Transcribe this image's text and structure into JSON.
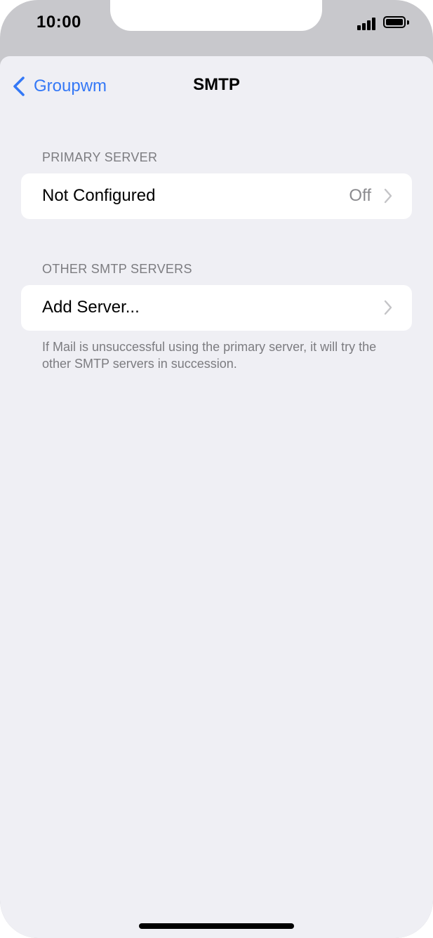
{
  "status_bar": {
    "time": "10:00",
    "signal_icon": "cellular-signal-icon",
    "battery_icon": "battery-icon"
  },
  "nav": {
    "back_label": "Groupwm",
    "back_icon": "chevron-left-icon",
    "title": "SMTP"
  },
  "primary_server": {
    "header": "PRIMARY SERVER",
    "row_label": "Not Configured",
    "row_value": "Off"
  },
  "other_servers": {
    "header": "OTHER SMTP SERVERS",
    "row_label": "Add Server...",
    "footer": "If Mail is unsuccessful using the primary server, it will try the other SMTP servers in succession."
  },
  "colors": {
    "accent": "#3478f6",
    "background": "#efeff4",
    "secondary_text": "#7c7c80"
  }
}
